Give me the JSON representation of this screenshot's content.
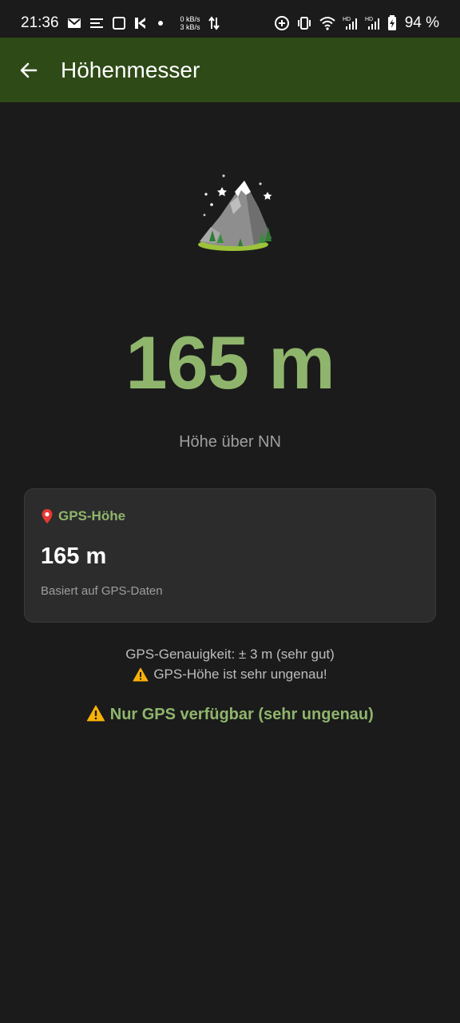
{
  "status_bar": {
    "time": "21:36",
    "net_up": "0 kB/s",
    "net_down": "3 kB/s",
    "battery_percent": "94 %",
    "icons": [
      "mail-icon",
      "notes-icon",
      "square-icon",
      "k-app-icon",
      "dot-icon",
      "data-arrows-icon",
      "add-circle-icon",
      "vibrate-icon",
      "wifi-icon",
      "signal-hd-icon",
      "signal-hd-icon",
      "battery-charging-icon"
    ]
  },
  "app_bar": {
    "title": "Höhenmesser",
    "back_icon": "arrow-left-icon",
    "color": "#2e4a17"
  },
  "hero": {
    "icon": "mountain-icon"
  },
  "altitude": {
    "value": "165 m",
    "label": "Höhe über NN",
    "color": "#8fb56c"
  },
  "gps_card": {
    "icon": "pin-icon",
    "title": "GPS-Höhe",
    "value": "165 m",
    "subtitle": "Basiert auf GPS-Daten"
  },
  "info": {
    "accuracy": "GPS-Genauigkeit: ± 3 m (sehr gut)",
    "warning": "GPS-Höhe ist sehr ungenau!",
    "warning_icon": "warning-icon"
  },
  "gps_only": {
    "text": "Nur GPS verfügbar (sehr ungenau)",
    "icon": "warning-icon"
  }
}
